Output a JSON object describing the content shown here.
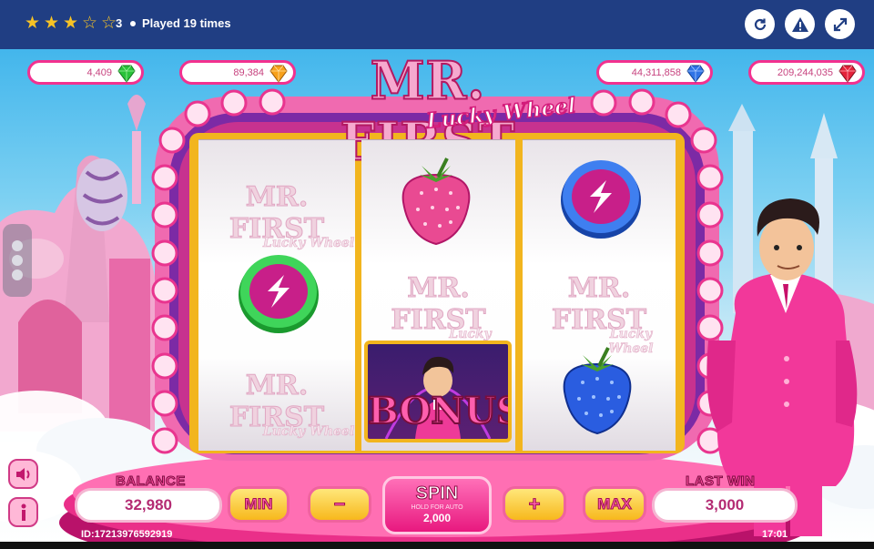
{
  "header": {
    "rating": {
      "stars_filled": 3,
      "stars_total": 5,
      "value": "3"
    },
    "played_text": "Played 19 times",
    "buttons": [
      "reload-icon",
      "warning-icon",
      "expand-icon"
    ]
  },
  "jackpots": [
    {
      "display": "4,409",
      "gem": "green-gem-icon"
    },
    {
      "display": "89,384",
      "gem": "orange-gem-icon"
    },
    {
      "display": "44,311,858",
      "gem": "blue-gem-icon"
    },
    {
      "display": "209,244,035",
      "gem": "red-gem-icon"
    }
  ],
  "logo": {
    "title": "MR. FIRST",
    "subtitle": "Lucky Wheel"
  },
  "reels": [
    {
      "symbols": [
        "logo",
        "green-bolt-coin-icon",
        "logo"
      ]
    },
    {
      "symbols": [
        "strawberry-icon",
        "logo",
        "bonus"
      ]
    },
    {
      "symbols": [
        "blue-bolt-coin-icon",
        "logo",
        "blueberry-icon"
      ]
    }
  ],
  "symbol_logo": {
    "title": "MR. FIRST",
    "subtitle": "Lucky Wheel"
  },
  "bonus_text": "BONUS",
  "controls": {
    "balance_label": "BALANCE",
    "balance": "32,980",
    "min_label": "MIN",
    "minus_label": "−",
    "spin_label": "SPIN",
    "spin_hint": "HOLD FOR AUTO",
    "bet": "2,000",
    "plus_label": "+",
    "max_label": "MAX",
    "last_win_label": "LAST WIN",
    "last_win": "3,000"
  },
  "footer": {
    "id": "ID:17213976592919",
    "time": "17:01"
  },
  "colors": {
    "topbar": "#203e83",
    "accent_pink": "#e8187f",
    "gold": "#f7b81c",
    "star": "#f7c325"
  }
}
